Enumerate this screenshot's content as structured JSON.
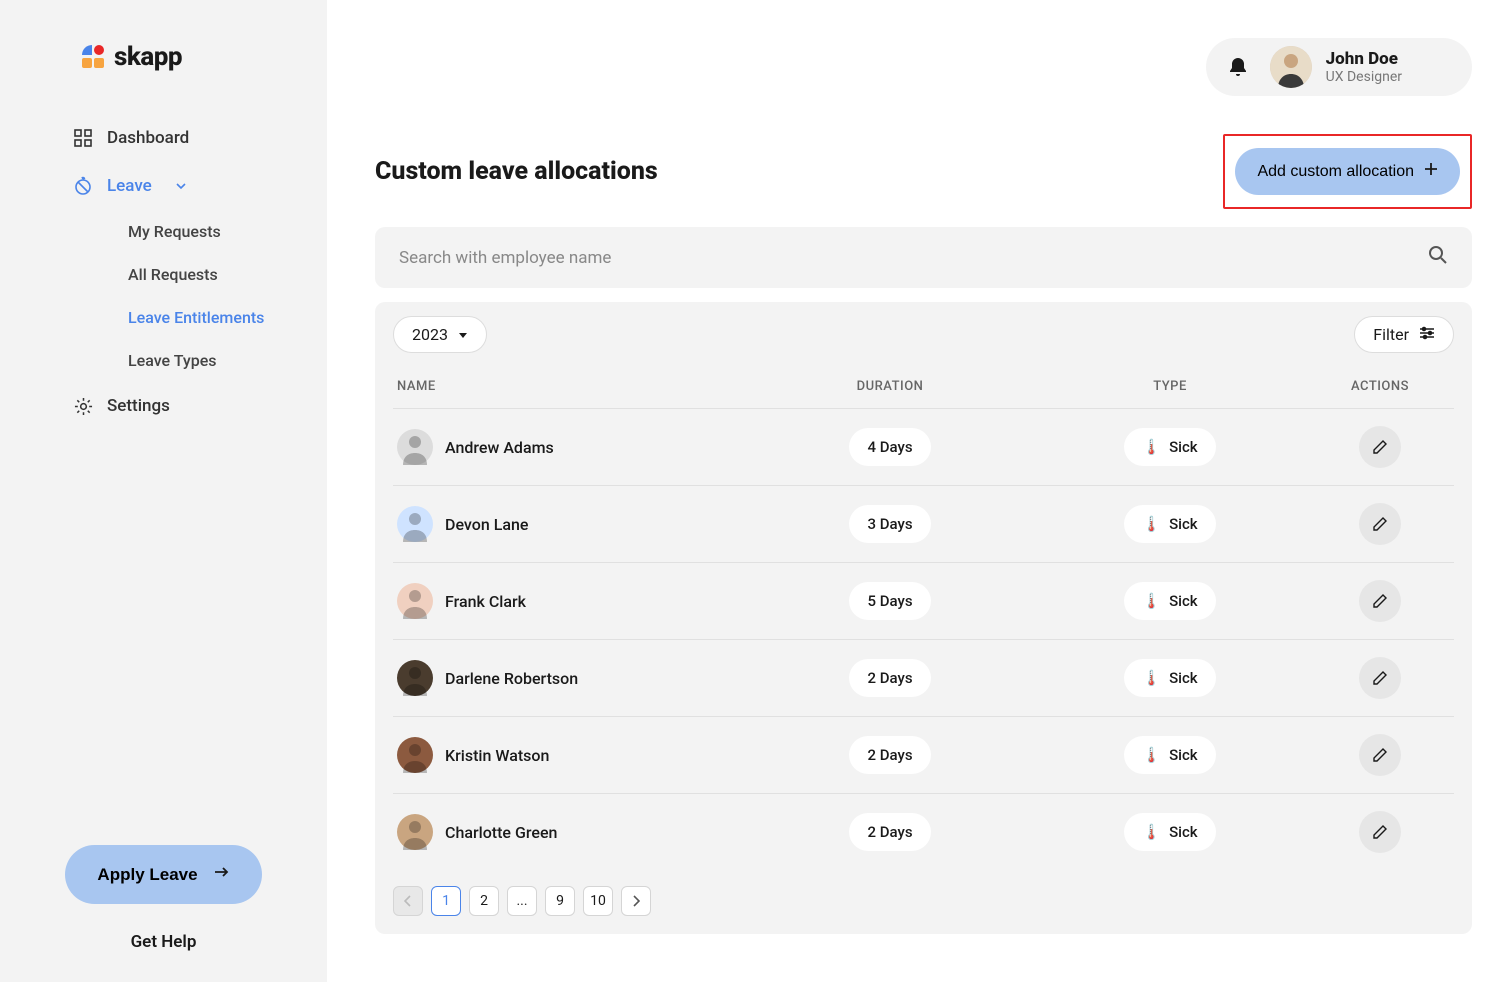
{
  "brand": {
    "name": "skapp"
  },
  "sidebar": {
    "nav": {
      "dashboard": "Dashboard",
      "leave": "Leave",
      "settings": "Settings"
    },
    "subnav": {
      "my_requests": "My Requests",
      "all_requests": "All Requests",
      "leave_entitlements": "Leave Entitlements",
      "leave_types": "Leave Types"
    },
    "apply_leave": "Apply Leave",
    "get_help": "Get Help"
  },
  "header": {
    "user_name": "John Doe",
    "user_role": "UX Designer"
  },
  "page": {
    "title": "Custom leave allocations",
    "add_button": "Add custom allocation",
    "search_placeholder": "Search with employee name",
    "year_selected": "2023",
    "filter_label": "Filter"
  },
  "table": {
    "headers": {
      "name": "NAME",
      "duration": "DURATION",
      "type": "TYPE",
      "actions": "ACTIONS"
    },
    "rows": [
      {
        "name": "Andrew Adams",
        "duration": "4 Days",
        "type": "Sick",
        "type_emoji": "🌡️",
        "avatar_bg": "#dcdcdc"
      },
      {
        "name": "Devon Lane",
        "duration": "3 Days",
        "type": "Sick",
        "type_emoji": "🌡️",
        "avatar_bg": "#cfe3ff"
      },
      {
        "name": "Frank Clark",
        "duration": "5 Days",
        "type": "Sick",
        "type_emoji": "🌡️",
        "avatar_bg": "#f0d0c0"
      },
      {
        "name": "Darlene Robertson",
        "duration": "2 Days",
        "type": "Sick",
        "type_emoji": "🌡️",
        "avatar_bg": "#4a3c2e"
      },
      {
        "name": "Kristin Watson",
        "duration": "2 Days",
        "type": "Sick",
        "type_emoji": "🌡️",
        "avatar_bg": "#8c5a3f"
      },
      {
        "name": "Charlotte Green",
        "duration": "2 Days",
        "type": "Sick",
        "type_emoji": "🌡️",
        "avatar_bg": "#c9a580"
      }
    ]
  },
  "pagination": {
    "pages": [
      "1",
      "2",
      "...",
      "9",
      "10"
    ],
    "active": "1"
  }
}
